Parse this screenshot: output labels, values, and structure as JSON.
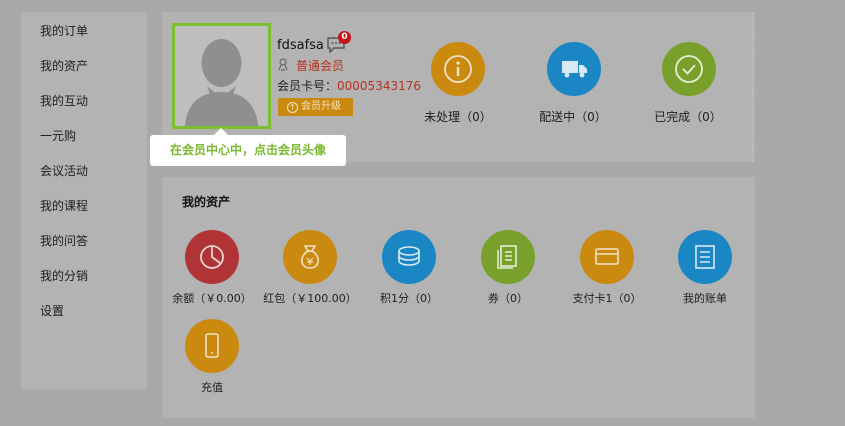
{
  "sidebar": {
    "items": [
      {
        "label": "我的订单"
      },
      {
        "label": "我的资产"
      },
      {
        "label": "我的互动"
      },
      {
        "label": "一元购"
      },
      {
        "label": "会议活动"
      },
      {
        "label": "我的课程"
      },
      {
        "label": "我的问答"
      },
      {
        "label": "我的分销"
      },
      {
        "label": "设置"
      }
    ]
  },
  "profile": {
    "username": "fdsafsa",
    "message_count": "0",
    "member_level": "普通会员",
    "card_label": "会员卡号：",
    "card_number": "00005343176",
    "upgrade_label": "会员升级",
    "tooltip": "在会员中心中，点击会员头像"
  },
  "order_status": [
    {
      "label": "未处理（0）",
      "color": "#c98a0f",
      "icon": "info-icon"
    },
    {
      "label": "配送中（0）",
      "color": "#1a86c4",
      "icon": "delivery-truck-icon"
    },
    {
      "label": "已完成（0）",
      "color": "#7aa02c",
      "icon": "check-circle-icon"
    }
  ],
  "assets": {
    "title": "我的资产",
    "items": [
      {
        "label": "余额（￥0.00）",
        "color": "#b03436",
        "icon": "pie-chart-icon"
      },
      {
        "label": "红包（￥100.00）",
        "color": "#c98a0f",
        "icon": "money-bag-icon"
      },
      {
        "label": "积1分（0）",
        "color": "#1a86c4",
        "icon": "coins-icon"
      },
      {
        "label": "券（0）",
        "color": "#7aa02c",
        "icon": "coupon-icon"
      },
      {
        "label": "支付卡1（0）",
        "color": "#c98a0f",
        "icon": "card-icon"
      },
      {
        "label": "我的账单",
        "color": "#1a86c4",
        "icon": "bill-icon"
      },
      {
        "label": "充值",
        "color": "#c98a0f",
        "icon": "phone-icon"
      }
    ]
  }
}
